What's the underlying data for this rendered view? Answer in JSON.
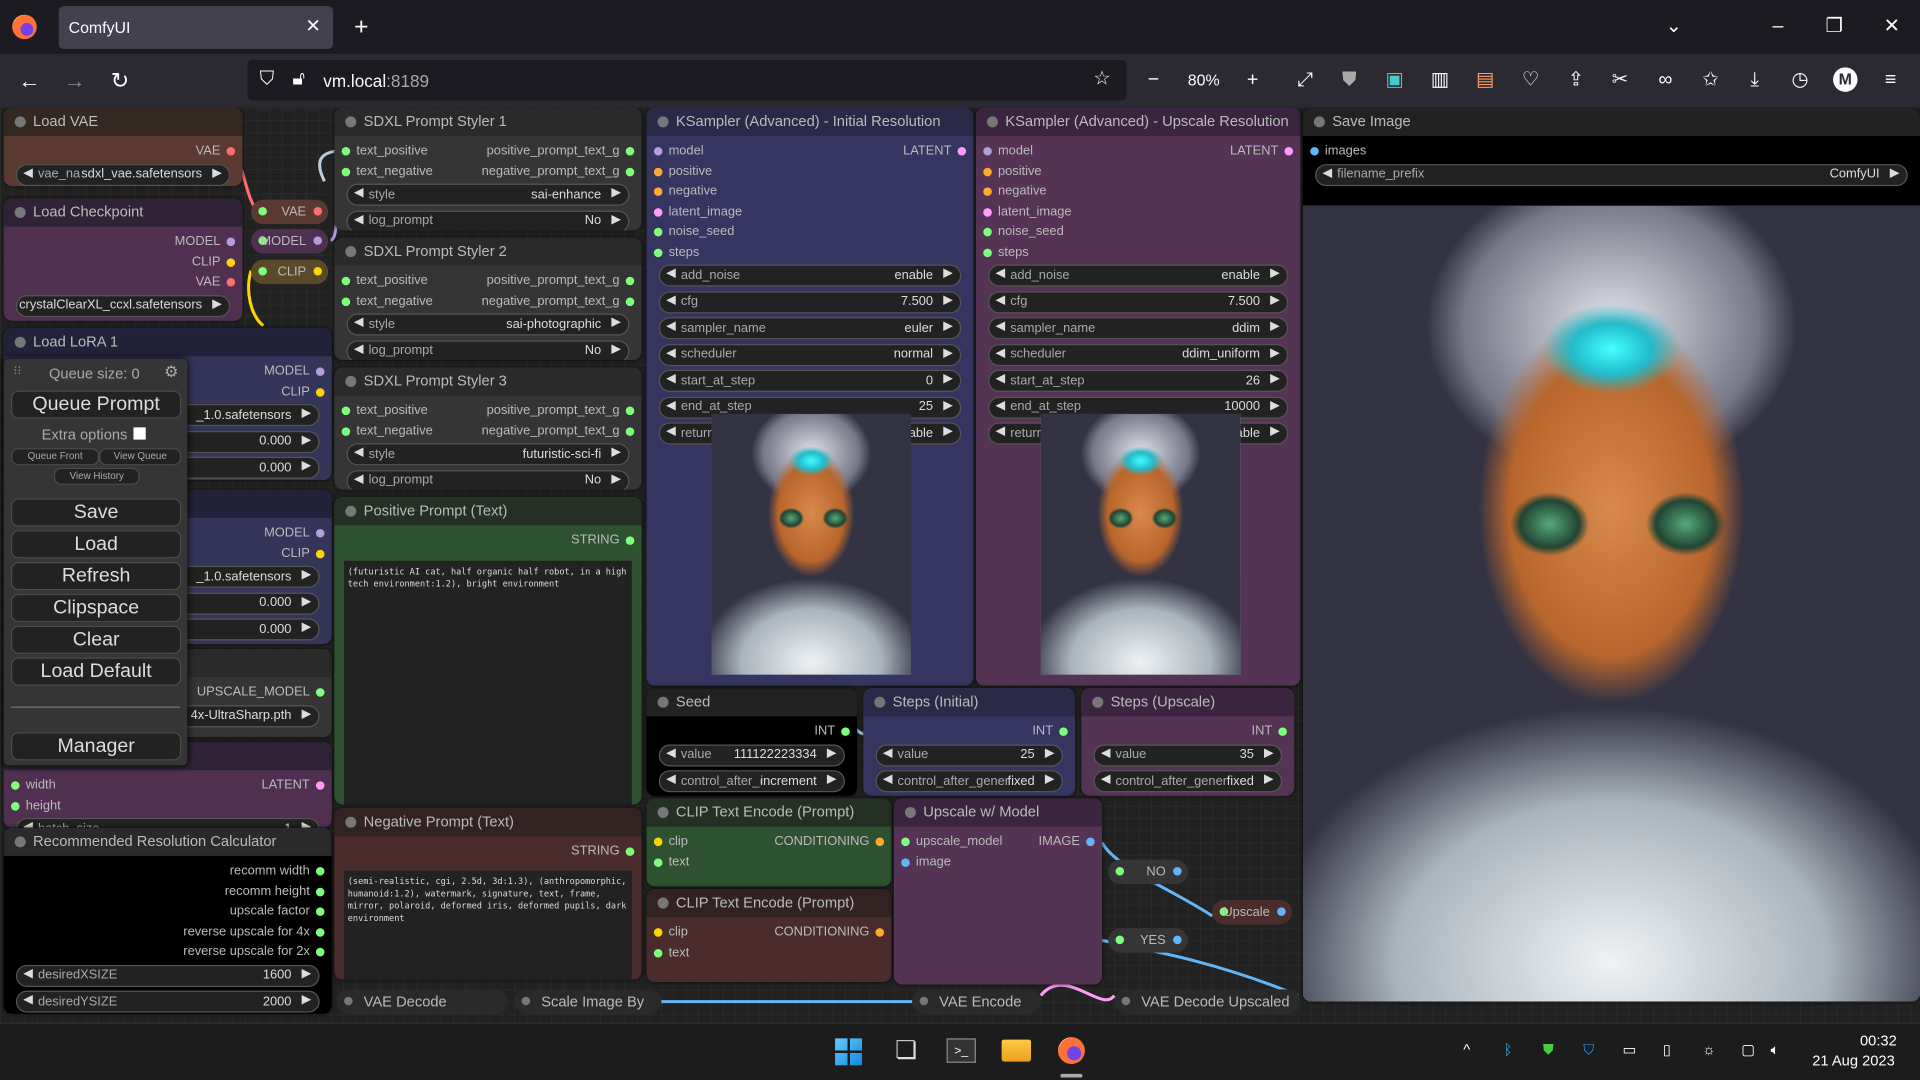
{
  "browser": {
    "tab_title": "ComfyUI",
    "url_host": "vm.local",
    "url_port": ":8189",
    "zoom": "80%",
    "toolbar_icons": [
      "back-icon",
      "forward-icon",
      "reload-icon",
      "shield-icon",
      "lock-icon",
      "star-icon",
      "zoom-out-icon",
      "zoom-in-icon",
      "fullscreen-icon",
      "ublock-icon",
      "save-icon",
      "extension-icon",
      "download-icon",
      "history-icon",
      "account-icon",
      "menu-icon"
    ],
    "account_initial": "M"
  },
  "queue_panel": {
    "queue_size": "Queue size: 0",
    "queue_prompt": "Queue Prompt",
    "extra_options": "Extra options",
    "queue_front": "Queue Front",
    "view_queue": "View Queue",
    "view_history": "View History",
    "save": "Save",
    "load": "Load",
    "refresh": "Refresh",
    "clipspace": "Clipspace",
    "clear": "Clear",
    "load_default": "Load Default",
    "manager": "Manager"
  },
  "slot_colors": {
    "model": "#b39ddb",
    "clip": "#ffd500",
    "vae": "#ff6e6e",
    "latent": "#ff9cf9",
    "cond": "#ffa931",
    "green": "#7dff7d",
    "image": "#64b5f6"
  },
  "nodes": {
    "load_vae": {
      "title": "Load VAE",
      "title_bg": "#332922",
      "bg": "#593930",
      "rows": [
        {
          "out": "VAE",
          "oc": "vae"
        }
      ],
      "widgets": [
        {
          "name": "vae_name",
          "value": "sdxl_vae.safetensors"
        }
      ]
    },
    "load_ckpt": {
      "title": "Load Checkpoint",
      "title_bg": "#2f2237",
      "bg": "#4f3050",
      "rows": [
        {
          "out": "MODEL",
          "oc": "model"
        },
        {
          "out": "CLIP",
          "oc": "clip"
        },
        {
          "out": "VAE",
          "oc": "vae"
        }
      ],
      "widgets": [
        {
          "name": "",
          "value": "crystalClearXL_ccxl.safetensors"
        }
      ]
    },
    "lora1": {
      "title": "Load LoRA 1",
      "title_bg": "#22223a",
      "bg": "#35355a",
      "rows": [
        {
          "out": "MODEL",
          "oc": "model"
        },
        {
          "out": "CLIP",
          "oc": "clip"
        }
      ],
      "widgets": [
        {
          "name": "",
          "value": "_1.0.safetensors"
        },
        {
          "name": "",
          "value": "0.000"
        },
        {
          "name": "",
          "value": "0.000"
        }
      ]
    },
    "lora2": {
      "title": "",
      "title_bg": "#22223a",
      "bg": "#35355a",
      "rows": [
        {
          "out": "MODEL",
          "oc": "model"
        },
        {
          "out": "CLIP",
          "oc": "clip"
        }
      ],
      "widgets": [
        {
          "name": "",
          "value": "_1.0.safetensors"
        },
        {
          "name": "",
          "value": "0.000"
        },
        {
          "name": "",
          "value": "0.000"
        }
      ]
    },
    "upscale_loader": {
      "title": "",
      "title_bg": "#2a2a2a",
      "bg": "#353535",
      "rows": [
        {
          "out": "UPSCALE_MODEL",
          "oc": "green"
        }
      ],
      "widgets": [
        {
          "name": "",
          "value": "4x-UltraSharp.pth"
        }
      ]
    },
    "empty_latent": {
      "title": "",
      "title_bg": "#2f2237",
      "bg": "#4f3050",
      "rows": [
        {
          "in": "width",
          "ic": "green",
          "out": "LATENT",
          "oc": "latent"
        },
        {
          "in": "height",
          "ic": "green"
        }
      ],
      "widgets": [
        {
          "name": "batch_size",
          "value": "1"
        }
      ]
    },
    "rrc": {
      "title": "Recommended Resolution Calculator",
      "title_bg": "#2a2a2a",
      "bg": "#000000",
      "rows": [
        {
          "out": "recomm width",
          "oc": "green"
        },
        {
          "out": "recomm height",
          "oc": "green"
        },
        {
          "out": "upscale factor",
          "oc": "green"
        },
        {
          "out": "reverse upscale for 4x",
          "oc": "green"
        },
        {
          "out": "reverse upscale for 2x",
          "oc": "green"
        }
      ],
      "widgets": [
        {
          "name": "desiredXSIZE",
          "value": "1600"
        },
        {
          "name": "desiredYSIZE",
          "value": "2000"
        }
      ]
    },
    "styler1": {
      "title": "SDXL Prompt Styler 1",
      "title_bg": "#2a2a2a",
      "bg": "#353535",
      "rows": [
        {
          "in": "text_positive",
          "ic": "green",
          "out": "positive_prompt_text_g",
          "oc": "green"
        },
        {
          "in": "text_negative",
          "ic": "green",
          "out": "negative_prompt_text_g",
          "oc": "green"
        }
      ],
      "widgets": [
        {
          "name": "style",
          "value": "sai-enhance"
        },
        {
          "name": "log_prompt",
          "value": "No"
        }
      ]
    },
    "styler2": {
      "title": "SDXL Prompt Styler 2",
      "title_bg": "#2a2a2a",
      "bg": "#353535",
      "rows": [
        {
          "in": "text_positive",
          "ic": "green",
          "out": "positive_prompt_text_g",
          "oc": "green"
        },
        {
          "in": "text_negative",
          "ic": "green",
          "out": "negative_prompt_text_g",
          "oc": "green"
        }
      ],
      "widgets": [
        {
          "name": "style",
          "value": "sai-photographic"
        },
        {
          "name": "log_prompt",
          "value": "No"
        }
      ]
    },
    "styler3": {
      "title": "SDXL Prompt Styler 3",
      "title_bg": "#2a2a2a",
      "bg": "#353535",
      "rows": [
        {
          "in": "text_positive",
          "ic": "green",
          "out": "positive_prompt_text_g",
          "oc": "green"
        },
        {
          "in": "text_negative",
          "ic": "green",
          "out": "negative_prompt_text_g",
          "oc": "green"
        }
      ],
      "widgets": [
        {
          "name": "style",
          "value": "futuristic-sci-fi"
        },
        {
          "name": "log_prompt",
          "value": "No"
        }
      ]
    },
    "pos_prompt": {
      "title": "Positive Prompt (Text)",
      "title_bg": "#233023",
      "bg": "#2e5230",
      "rows": [
        {
          "out": "STRING",
          "oc": "green"
        }
      ],
      "widgets": [],
      "text": "(futuristic AI cat, half organic half robot, in a high tech environment:1.2), bright environment"
    },
    "neg_prompt": {
      "title": "Negative Prompt (Text)",
      "title_bg": "#332222",
      "bg": "#4a2c2c",
      "rows": [
        {
          "out": "STRING",
          "oc": "green"
        }
      ],
      "widgets": [],
      "text": "(semi-realistic, cgi, 2.5d, 3d:1.3), (anthropomorphic, humanoid:1.2), watermark, signature, text, frame, mirror, polaroid, deformed iris, deformed pupils, dark environment"
    },
    "ks1": {
      "title": "KSampler (Advanced) - Initial Resolution",
      "title_bg": "#2a2a48",
      "bg": "#353560",
      "rows": [
        {
          "in": "model",
          "ic": "model",
          "out": "LATENT",
          "oc": "latent"
        },
        {
          "in": "positive",
          "ic": "cond"
        },
        {
          "in": "negative",
          "ic": "cond"
        },
        {
          "in": "latent_image",
          "ic": "latent"
        },
        {
          "in": "noise_seed",
          "ic": "green"
        },
        {
          "in": "steps",
          "ic": "green"
        }
      ],
      "widgets": [
        {
          "name": "add_noise",
          "value": "enable"
        },
        {
          "name": "cfg",
          "value": "7.500"
        },
        {
          "name": "sampler_name",
          "value": "euler"
        },
        {
          "name": "scheduler",
          "value": "normal"
        },
        {
          "name": "start_at_step",
          "value": "0"
        },
        {
          "name": "end_at_step",
          "value": "25"
        },
        {
          "name": "return_with_leftover_noise",
          "value": "disable"
        }
      ]
    },
    "ks2": {
      "title": "KSampler (Advanced) - Upscale Resolution",
      "title_bg": "#3a2440",
      "bg": "#553355",
      "rows": [
        {
          "in": "model",
          "ic": "model",
          "out": "LATENT",
          "oc": "latent"
        },
        {
          "in": "positive",
          "ic": "cond"
        },
        {
          "in": "negative",
          "ic": "cond"
        },
        {
          "in": "latent_image",
          "ic": "latent"
        },
        {
          "in": "noise_seed",
          "ic": "green"
        },
        {
          "in": "steps",
          "ic": "green"
        }
      ],
      "widgets": [
        {
          "name": "add_noise",
          "value": "enable"
        },
        {
          "name": "cfg",
          "value": "7.500"
        },
        {
          "name": "sampler_name",
          "value": "ddim"
        },
        {
          "name": "scheduler",
          "value": "ddim_uniform"
        },
        {
          "name": "start_at_step",
          "value": "26"
        },
        {
          "name": "end_at_step",
          "value": "10000"
        },
        {
          "name": "return_with_leftover_noise",
          "value": "disable"
        }
      ]
    },
    "save": {
      "title": "Save Image",
      "title_bg": "#222222",
      "bg": "#000000",
      "rows": [
        {
          "in": "images",
          "ic": "image"
        }
      ],
      "widgets": [
        {
          "name": "filename_prefix",
          "value": "ComfyUI"
        }
      ]
    },
    "seed": {
      "title": "Seed",
      "title_bg": "#222222",
      "bg": "#000000",
      "rows": [
        {
          "out": "INT",
          "oc": "green"
        }
      ],
      "widgets": [
        {
          "name": "value",
          "value": "111122223334"
        },
        {
          "name": "control_after_generate",
          "value": "increment"
        }
      ]
    },
    "steps_init": {
      "title": "Steps (Initial)",
      "title_bg": "#2a2a48",
      "bg": "#353560",
      "rows": [
        {
          "out": "INT",
          "oc": "green"
        }
      ],
      "widgets": [
        {
          "name": "value",
          "value": "25"
        },
        {
          "name": "control_after_generate",
          "value": "fixed"
        }
      ]
    },
    "steps_up": {
      "title": "Steps (Upscale)",
      "title_bg": "#3a2440",
      "bg": "#553355",
      "rows": [
        {
          "out": "INT",
          "oc": "green"
        }
      ],
      "widgets": [
        {
          "name": "value",
          "value": "35"
        },
        {
          "name": "control_after_generate",
          "value": "fixed"
        }
      ]
    },
    "clip1": {
      "title": "CLIP Text Encode (Prompt)",
      "title_bg": "#233023",
      "bg": "#2e5230",
      "rows": [
        {
          "in": "clip",
          "ic": "clip",
          "out": "CONDITIONING",
          "oc": "cond"
        },
        {
          "in": "text",
          "ic": "green"
        }
      ],
      "widgets": []
    },
    "clip2": {
      "title": "CLIP Text Encode (Prompt)",
      "title_bg": "#332222",
      "bg": "#4a2c2c",
      "rows": [
        {
          "in": "clip",
          "ic": "clip",
          "out": "CONDITIONING",
          "oc": "cond"
        },
        {
          "in": "text",
          "ic": "green"
        }
      ],
      "widgets": []
    },
    "upscale_model": {
      "title": "Upscale w/ Model",
      "title_bg": "#3a2440",
      "bg": "#553355",
      "rows": [
        {
          "in": "upscale_model",
          "ic": "green",
          "out": "IMAGE",
          "oc": "image"
        },
        {
          "in": "image",
          "ic": "image"
        }
      ],
      "widgets": []
    }
  },
  "collapsed": {
    "reroute_vae": "VAE",
    "reroute_model": "MODEL",
    "reroute_clip": "CLIP",
    "no": "NO",
    "yes": "YES",
    "upscale": "Upscale",
    "vae_decode": "VAE Decode",
    "scale_image": "Scale Image By",
    "vae_encode": "VAE Encode",
    "vae_decode_up": "VAE Decode Upscaled"
  },
  "taskbar": {
    "apps": [
      "windows-start-icon",
      "task-view-icon",
      "terminal-icon",
      "file-explorer-icon",
      "firefox-icon"
    ],
    "time": "00:32",
    "date": "21 Aug 2023"
  }
}
